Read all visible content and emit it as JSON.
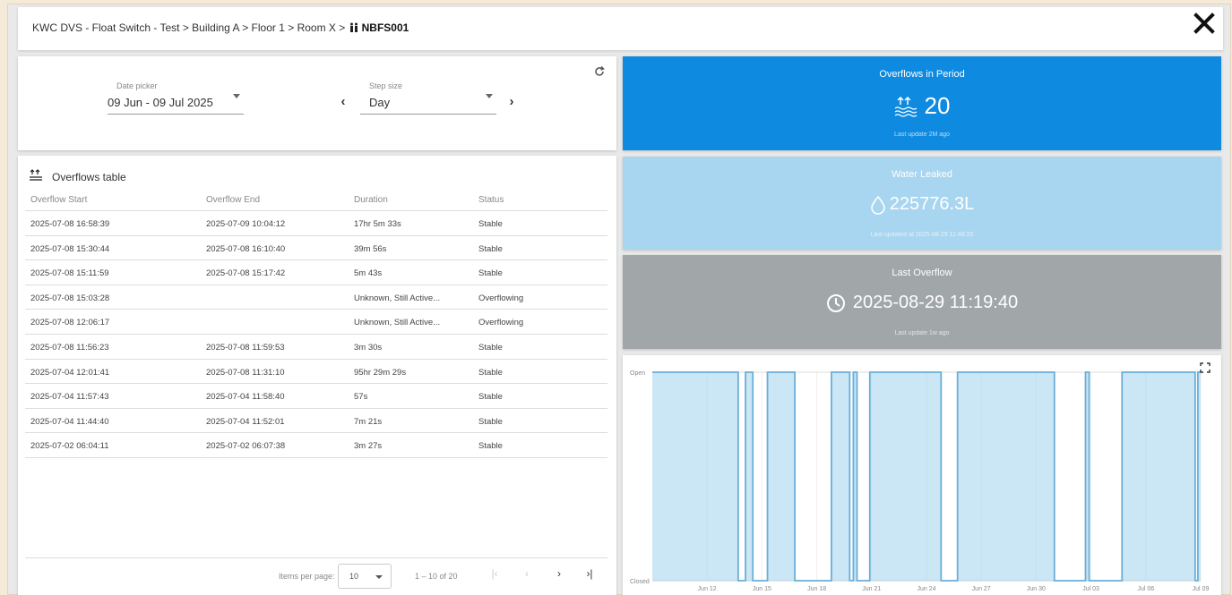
{
  "breadcrumb": {
    "path": "KWC DVS - Float Switch - Test > Building A > Floor 1 > Room X >",
    "device": "NBFS001"
  },
  "controls": {
    "date_picker_label": "Date picker",
    "date_picker_value": "09 Jun - 09 Jul 2025",
    "step_size_label": "Step size",
    "step_size_value": "Day",
    "prev": "‹",
    "next": "›"
  },
  "table": {
    "title": "Overflows table",
    "columns": [
      "Overflow Start",
      "Overflow End",
      "Duration",
      "Status"
    ],
    "rows": [
      [
        "2025-07-08 16:58:39",
        "2025-07-09 10:04:12",
        "17hr 5m 33s",
        "Stable"
      ],
      [
        "2025-07-08 15:30:44",
        "2025-07-08 16:10:40",
        "39m 56s",
        "Stable"
      ],
      [
        "2025-07-08 15:11:59",
        "2025-07-08 15:17:42",
        "5m 43s",
        "Stable"
      ],
      [
        "2025-07-08 15:03:28",
        "",
        "Unknown, Still Active...",
        "Overflowing"
      ],
      [
        "2025-07-08 12:06:17",
        "",
        "Unknown, Still Active...",
        "Overflowing"
      ],
      [
        "2025-07-08 11:56:23",
        "2025-07-08 11:59:53",
        "3m 30s",
        "Stable"
      ],
      [
        "2025-07-04 12:01:41",
        "2025-07-08 11:31:10",
        "95hr 29m 29s",
        "Stable"
      ],
      [
        "2025-07-04 11:57:43",
        "2025-07-04 11:58:40",
        "57s",
        "Stable"
      ],
      [
        "2025-07-04 11:44:40",
        "2025-07-04 11:52:01",
        "7m 21s",
        "Stable"
      ],
      [
        "2025-07-02 06:04:11",
        "2025-07-02 06:07:38",
        "3m 27s",
        "Stable"
      ]
    ],
    "items_per_page_label": "Items per page:",
    "items_per_page_value": "10",
    "range_label": "1 – 10 of 20",
    "pager": {
      "first": "|‹",
      "prev": "‹",
      "next": "›",
      "last": "›|"
    }
  },
  "tiles": {
    "overflows": {
      "title": "Overflows in Period",
      "value": "20",
      "sub": "Last update 2M ago",
      "color": "#0e8ae0"
    },
    "water": {
      "title": "Water Leaked",
      "value": "225776.3L",
      "sub": "Last updated at 2025-08-29 11:48:20",
      "color": "#a8d5ef"
    },
    "last": {
      "title": "Last Overflow",
      "value": "2025-08-29 11:19:40",
      "sub": "Last update 1w ago",
      "color": "#a1a6a9"
    }
  },
  "chart_data": {
    "type": "area",
    "y_categories": [
      "Closed",
      "Open"
    ],
    "x_ticks": [
      "Jun 12",
      "Jun 15",
      "Jun 18",
      "Jun 21",
      "Jun 24",
      "Jun 27",
      "Jun 30",
      "Jul 03",
      "Jul 06",
      "Jul 09"
    ],
    "x_range_days": [
      9,
      39
    ],
    "state_changes": [
      {
        "day": 9.0,
        "state": 1
      },
      {
        "day": 13.7,
        "state": 0
      },
      {
        "day": 14.1,
        "state": 1
      },
      {
        "day": 14.5,
        "state": 0
      },
      {
        "day": 15.3,
        "state": 1
      },
      {
        "day": 16.8,
        "state": 0
      },
      {
        "day": 18.8,
        "state": 1
      },
      {
        "day": 19.8,
        "state": 0
      },
      {
        "day": 20.0,
        "state": 1
      },
      {
        "day": 20.2,
        "state": 0
      },
      {
        "day": 20.9,
        "state": 1
      },
      {
        "day": 24.8,
        "state": 0
      },
      {
        "day": 25.7,
        "state": 1
      },
      {
        "day": 31.0,
        "state": 0
      },
      {
        "day": 32.7,
        "state": 1
      },
      {
        "day": 32.9,
        "state": 0
      },
      {
        "day": 34.7,
        "state": 1
      },
      {
        "day": 38.7,
        "state": 0
      },
      {
        "day": 38.85,
        "state": 1
      },
      {
        "day": 39.0,
        "state": 1
      }
    ],
    "series_color": "#a8d5ef",
    "line_color": "#6aafd8"
  }
}
